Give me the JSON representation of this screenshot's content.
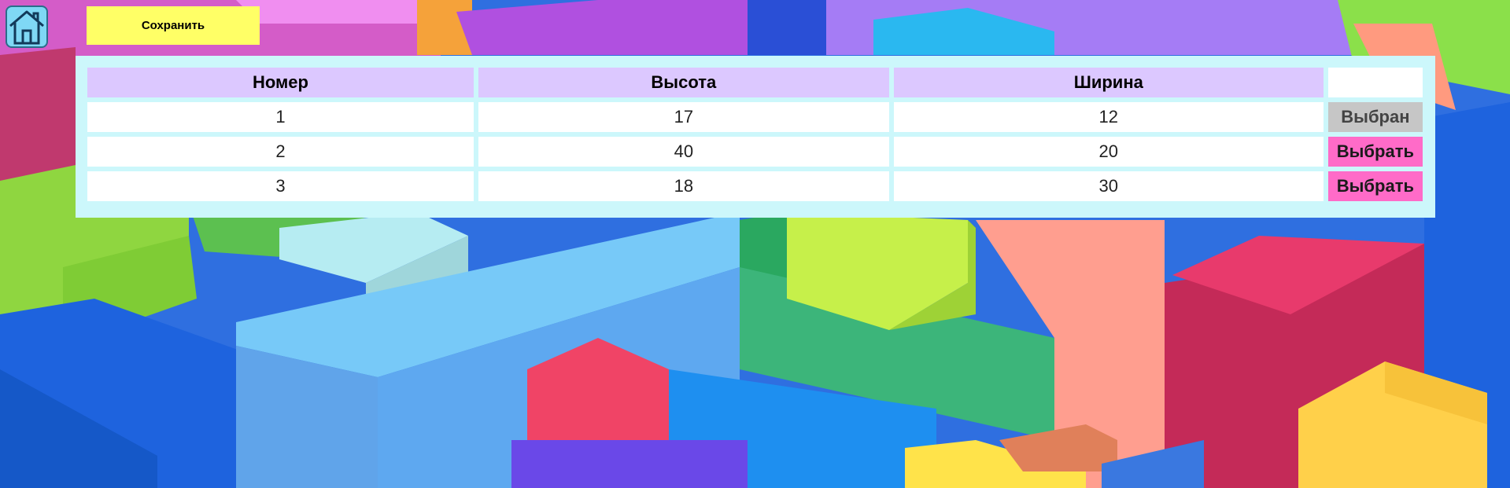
{
  "header": {
    "save_label": "Сохранить",
    "home_icon": "home-icon"
  },
  "table": {
    "columns": [
      "Номер",
      "Высота",
      "Ширина",
      ""
    ],
    "rows": [
      {
        "number": "1",
        "height": "17",
        "width": "12",
        "action": "Выбран",
        "state": "selected"
      },
      {
        "number": "2",
        "height": "40",
        "width": "20",
        "action": "Выбрать",
        "state": "choose"
      },
      {
        "number": "3",
        "height": "18",
        "width": "30",
        "action": "Выбрать",
        "state": "choose"
      }
    ]
  },
  "colors": {
    "save_button": "#ffff66",
    "panel": "#ccf7fb",
    "header_cell": "#dcc8ff",
    "selected_button": "#c6c6c6",
    "choose_button": "#ff6bc8",
    "home_button": "#7fd8f5"
  }
}
